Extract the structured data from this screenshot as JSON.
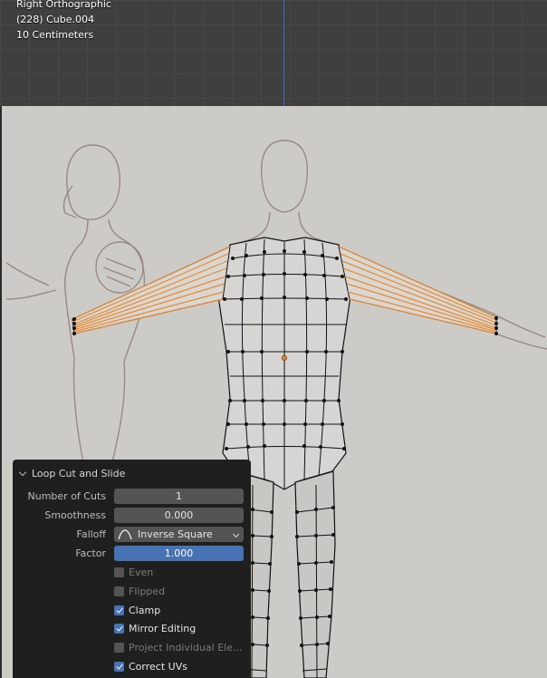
{
  "viewport": {
    "view_name": "Right Orthographic",
    "object_name": "(228) Cube.004",
    "grid_scale": "10 Centimeters"
  },
  "operator_panel": {
    "title": "Loop Cut and Slide",
    "number_of_cuts_label": "Number of Cuts",
    "number_of_cuts_value": "1",
    "smoothness_label": "Smoothness",
    "smoothness_value": "0.000",
    "falloff_label": "Falloff",
    "falloff_value": "Inverse Square",
    "factor_label": "Factor",
    "factor_value": "1.000",
    "checkboxes": [
      {
        "label": "Even",
        "checked": false
      },
      {
        "label": "Flipped",
        "checked": false
      },
      {
        "label": "Clamp",
        "checked": true
      },
      {
        "label": "Mirror Editing",
        "checked": true
      },
      {
        "label": "Project Individual Ele...",
        "checked": false
      },
      {
        "label": "Correct UVs",
        "checked": true
      }
    ]
  },
  "colors": {
    "accent": "#4772b3",
    "selection": "#e88a2e",
    "axis_blue": "#3d6bd6"
  }
}
